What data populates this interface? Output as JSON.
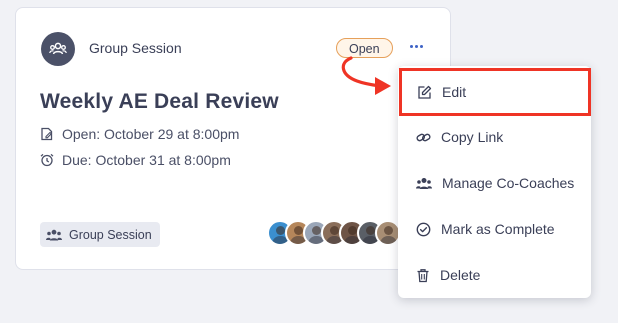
{
  "card": {
    "type_label": "Group Session",
    "status": "Open",
    "title": "Weekly AE Deal Review",
    "open_text": "Open: October 29 at 8:00pm",
    "due_text": "Due: October 31 at 8:00pm",
    "tag_label": "Group Session",
    "participants": [
      {
        "color": "#3b8fcf"
      },
      {
        "color": "#b5865a"
      },
      {
        "color": "#9aa6b8"
      },
      {
        "color": "#8a6e5a"
      },
      {
        "color": "#6e5446"
      },
      {
        "color": "#5a5f66"
      },
      {
        "color": "#a88e74"
      }
    ]
  },
  "menu": {
    "items": [
      {
        "label": "Edit",
        "icon": "edit-icon"
      },
      {
        "label": "Copy Link",
        "icon": "link-icon"
      },
      {
        "label": "Manage Co-Coaches",
        "icon": "users-icon"
      },
      {
        "label": "Mark as Complete",
        "icon": "check-circle-icon"
      },
      {
        "label": "Delete",
        "icon": "trash-icon"
      }
    ]
  },
  "colors": {
    "highlight": "#ef3425",
    "accent": "#3f63c6",
    "badge_border": "#e6a05a"
  }
}
